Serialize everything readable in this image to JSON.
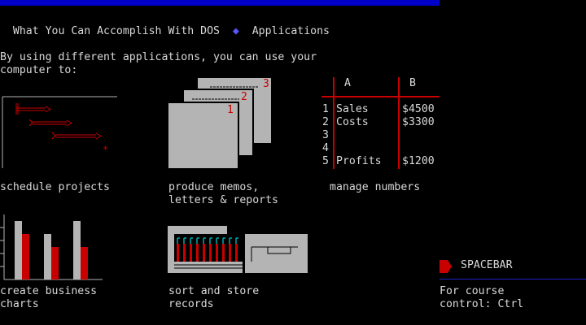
{
  "header": {
    "title": "What You Can Accomplish With DOS",
    "separator": "◆",
    "section": "Applications"
  },
  "intro": {
    "line1": "By using different applications, you can use your",
    "line2": "computer to:"
  },
  "items": {
    "schedule": {
      "label": "schedule projects"
    },
    "memos": {
      "line1": "produce memos,",
      "line2": "letters & reports",
      "page_numbers": [
        "1",
        "2",
        "3"
      ]
    },
    "numbers": {
      "label": "manage numbers",
      "columns": [
        "A",
        "B"
      ],
      "rows": [
        {
          "num": "1",
          "a": "Sales",
          "b": "$4500"
        },
        {
          "num": "2",
          "a": "Costs",
          "b": "$3300"
        },
        {
          "num": "3",
          "a": "",
          "b": ""
        },
        {
          "num": "4",
          "a": "",
          "b": ""
        },
        {
          "num": "5",
          "a": "Profits",
          "b": "$1200"
        }
      ]
    },
    "charts": {
      "line1": "create business",
      "line2": "charts"
    },
    "records": {
      "line1": "sort and store",
      "line2": "records"
    }
  },
  "footer": {
    "spacebar_label": "SPACEBAR",
    "course_line1": "For course",
    "course_line2": "control: Ctrl"
  },
  "colors": {
    "background": "#000000",
    "text": "#d8d8d8",
    "accent_blue": "#0000c8",
    "accent_red": "#c80000",
    "graphic_gray": "#b4b4b4"
  }
}
